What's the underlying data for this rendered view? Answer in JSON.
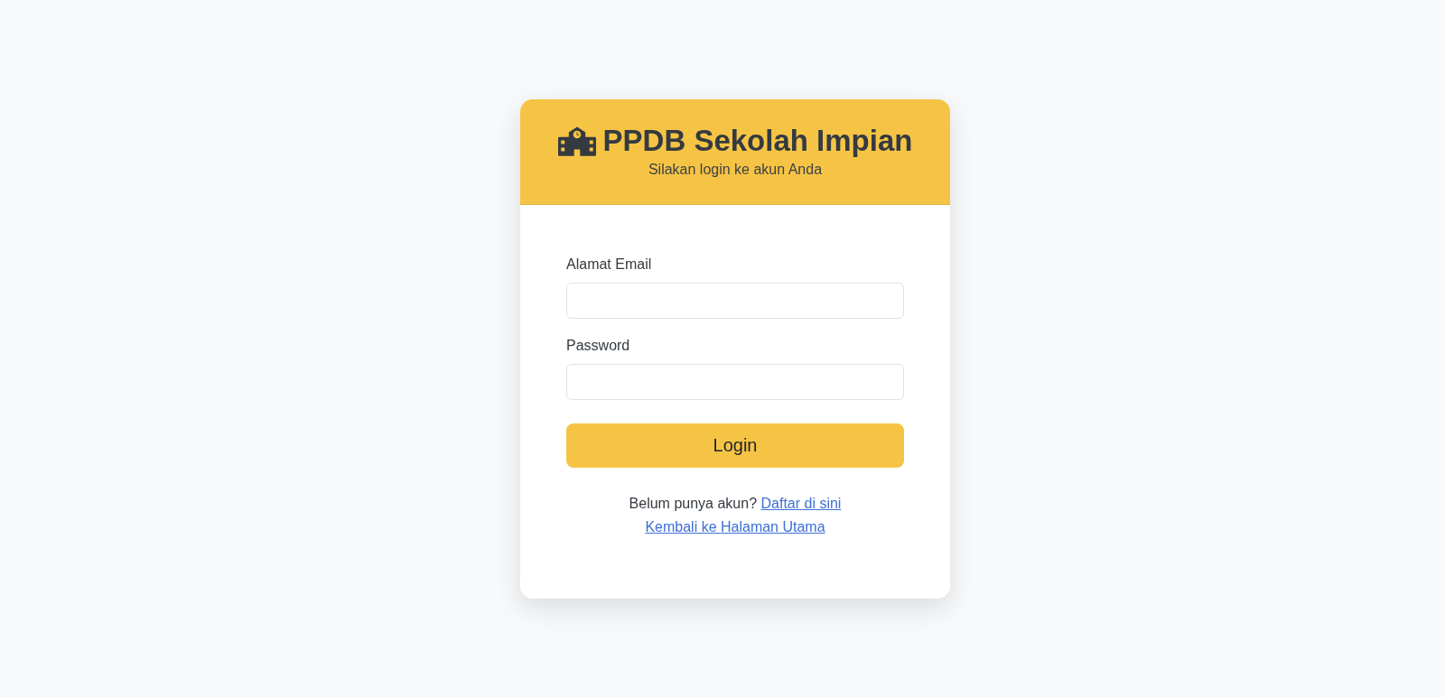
{
  "header": {
    "title": "PPDB Sekolah Impian",
    "subtitle": "Silakan login ke akun Anda"
  },
  "form": {
    "fields": [
      {
        "label": "Alamat Email"
      },
      {
        "label": "Password"
      }
    ],
    "submit": "Login"
  },
  "footer": {
    "prompt": "Belum punya akun?",
    "register_link": "Daftar di sini",
    "home_link": "Kembali ke Halaman Utama"
  }
}
